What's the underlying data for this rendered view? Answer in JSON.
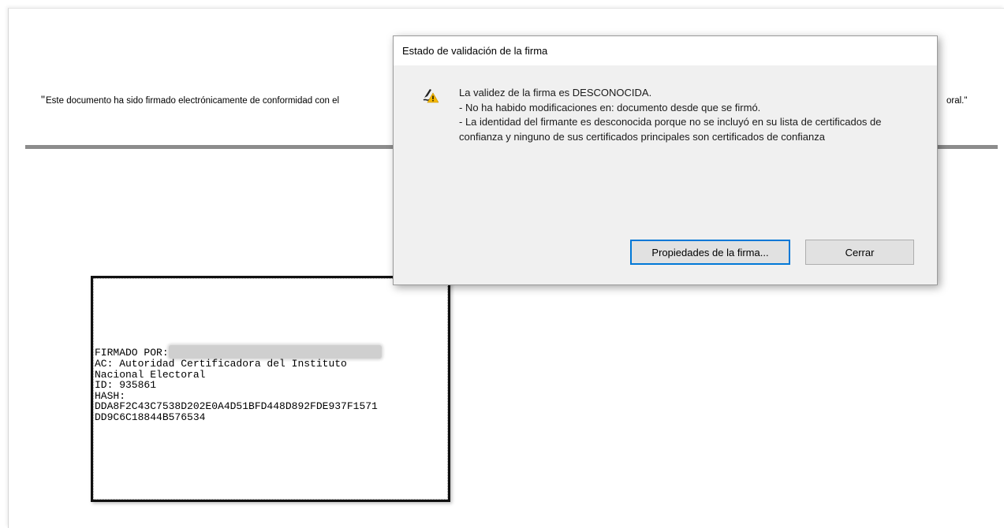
{
  "document": {
    "statement_start": "Este documento ha sido firmado electrónicamente de conformidad con el",
    "statement_end": "oral.\"",
    "open_quote": "\""
  },
  "signature_block": {
    "lines": [
      "FIRMADO POR:",
      "AC: Autoridad Certificadora del Instituto",
      "Nacional Electoral",
      "ID: 935861",
      "HASH:",
      "DDA8F2C43C7538D202E0A4D51BFD448D892FDE937F1571",
      "DD9C6C18844B576534"
    ]
  },
  "dialog": {
    "title": "Estado de validación de la firma",
    "icon": "signature-warning-icon",
    "message_lines": [
      "La validez de la firma es DESCONOCIDA.",
      "- No ha habido modificaciones en: documento desde que se firmó.",
      "- La identidad del firmante es desconocida porque no se incluyó en su lista de certificados de confianza y ninguno de sus certificados principales son certificados de confianza"
    ],
    "buttons": {
      "properties": "Propiedades de la firma...",
      "close": "Cerrar"
    }
  },
  "colors": {
    "warning": "#f5b800",
    "primary_border": "#0078d7",
    "divider": "#8c8c8c"
  }
}
